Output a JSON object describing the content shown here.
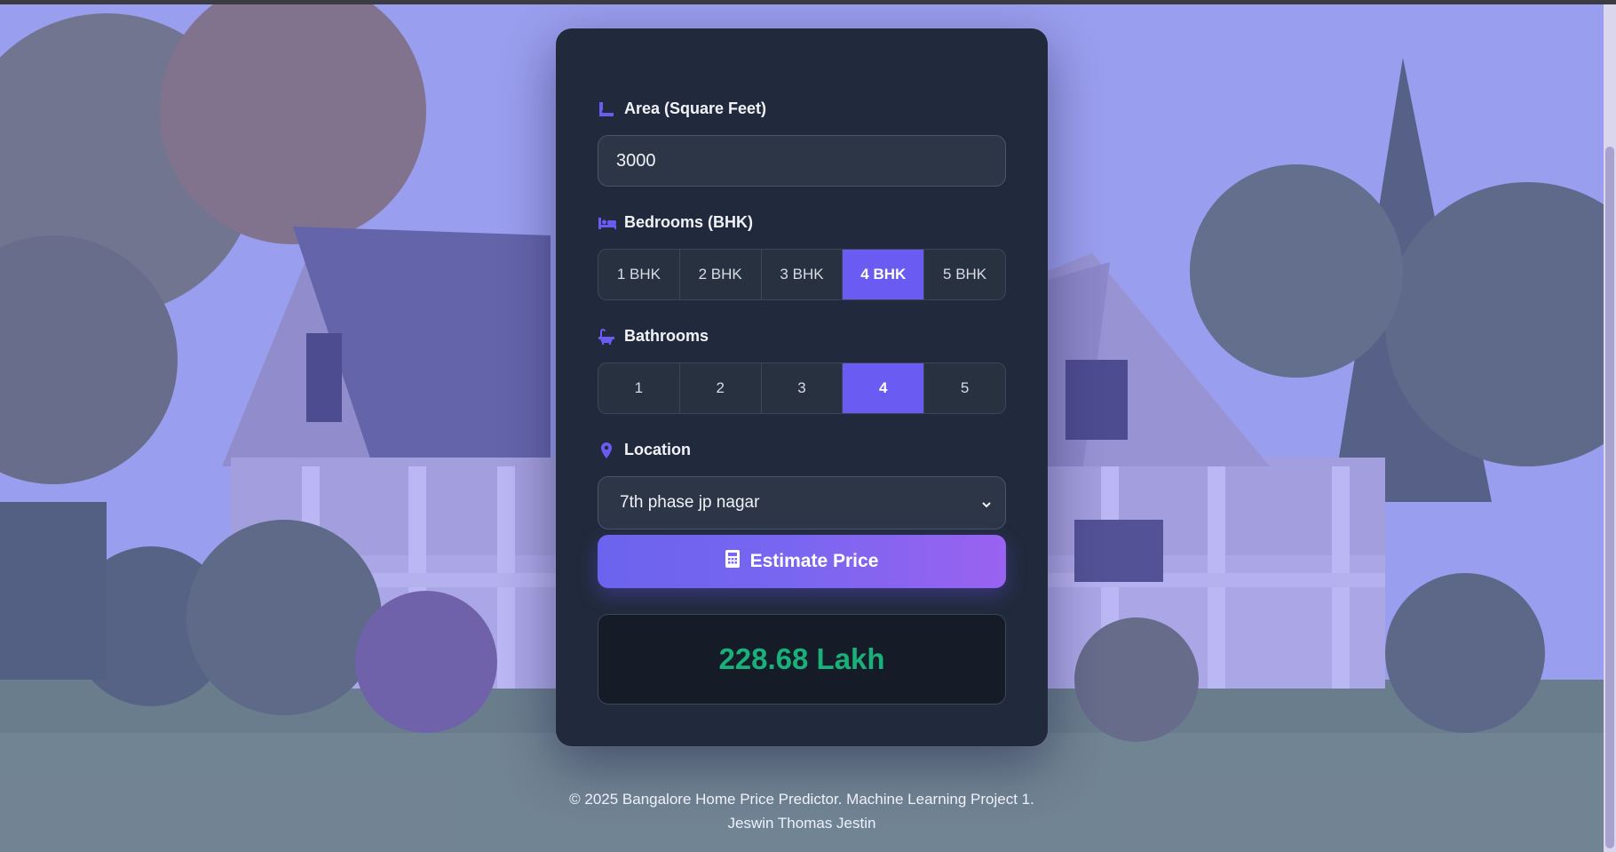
{
  "form": {
    "area": {
      "icon": "ruler-icon",
      "label": "Area (Square Feet)",
      "value": "3000"
    },
    "bedrooms": {
      "icon": "bed-icon",
      "label": "Bedrooms (BHK)",
      "options": [
        "1 BHK",
        "2 BHK",
        "3 BHK",
        "4 BHK",
        "5 BHK"
      ],
      "selected": "4 BHK"
    },
    "bathrooms": {
      "icon": "bath-icon",
      "label": "Bathrooms",
      "options": [
        "1",
        "2",
        "3",
        "4",
        "5"
      ],
      "selected": "4"
    },
    "location": {
      "icon": "location-pin-icon",
      "label": "Location",
      "selected": "7th phase jp nagar"
    },
    "submit": {
      "icon": "calculator-icon",
      "label": "Estimate Price"
    }
  },
  "result": {
    "value": "228.68 Lakh"
  },
  "footer": {
    "line1": "© 2025 Bangalore Home Price Predictor. Machine Learning Project 1.",
    "line2": "Jeswin Thomas Jestin"
  },
  "colors": {
    "accent": "#6a5cf2",
    "card": "#212a3c",
    "result_text": "#19b07a",
    "overlay": "#766af5"
  }
}
